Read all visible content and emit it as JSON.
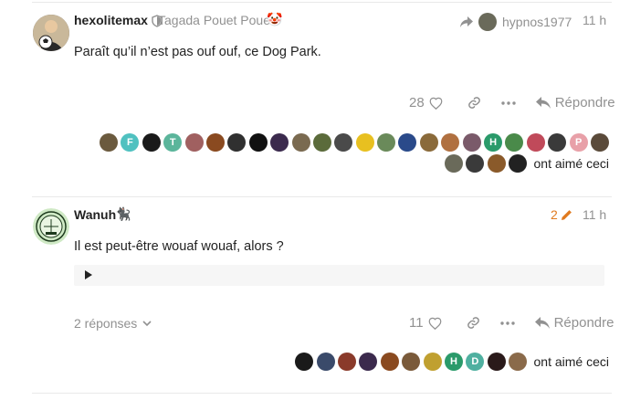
{
  "post1": {
    "username": "hexolitemax",
    "user_title": "Tagada Pouet Pouet",
    "title_emoji": "🤡",
    "reply_to": "hypnos1977",
    "time": "11 h",
    "body": "Paraît qu’il n’est pas ouf ouf, ce Dog Park.",
    "like_count": "28",
    "reply_label": "Répondre",
    "liked_text": "ont aimé ceci",
    "likers": [
      {
        "c": "#6b5a3e",
        "t": ""
      },
      {
        "c": "#4fc1c0",
        "t": "F"
      },
      {
        "c": "#1a1a1a",
        "t": ""
      },
      {
        "c": "#5bb59b",
        "t": "T"
      },
      {
        "c": "#a06060",
        "t": ""
      },
      {
        "c": "#8a4a20",
        "t": ""
      },
      {
        "c": "#303030",
        "t": ""
      },
      {
        "c": "#111111",
        "t": ""
      },
      {
        "c": "#3b2a4d",
        "t": ""
      },
      {
        "c": "#7a6a50",
        "t": ""
      },
      {
        "c": "#5b6b3b",
        "t": ""
      },
      {
        "c": "#4a4a4a",
        "t": ""
      },
      {
        "c": "#e8c020",
        "t": ""
      },
      {
        "c": "#6a8a5a",
        "t": ""
      },
      {
        "c": "#2a4a8a",
        "t": ""
      },
      {
        "c": "#8a6a3a",
        "t": ""
      },
      {
        "c": "#b07040",
        "t": ""
      },
      {
        "c": "#7a5a6a",
        "t": ""
      },
      {
        "c": "#2a9a6a",
        "t": "H"
      },
      {
        "c": "#4a8a4a",
        "t": ""
      },
      {
        "c": "#c04a5a",
        "t": ""
      },
      {
        "c": "#3a3a3a",
        "t": ""
      },
      {
        "c": "#e8a0a8",
        "t": "P"
      },
      {
        "c": "#5a4a3a",
        "t": ""
      },
      {
        "c": "#6a6a5a",
        "t": ""
      },
      {
        "c": "#3a3a3a",
        "t": ""
      },
      {
        "c": "#8a5a2a",
        "t": ""
      },
      {
        "c": "#222222",
        "t": ""
      }
    ]
  },
  "post2": {
    "username": "Wanuh",
    "edit_count": "2",
    "time": "11 h",
    "body": "Il est peut-être wouaf wouaf, alors ?",
    "replies_label": "2 réponses",
    "like_count": "11",
    "reply_label": "Répondre",
    "liked_text": "ont aimé ceci",
    "likers": [
      {
        "c": "#1a1a1a",
        "t": ""
      },
      {
        "c": "#3a4a6a",
        "t": ""
      },
      {
        "c": "#8a3a2a",
        "t": ""
      },
      {
        "c": "#3b2a4d",
        "t": ""
      },
      {
        "c": "#8a4a20",
        "t": ""
      },
      {
        "c": "#7a5a3a",
        "t": ""
      },
      {
        "c": "#c0a030",
        "t": ""
      },
      {
        "c": "#2a9a6a",
        "t": "H"
      },
      {
        "c": "#4fb0a0",
        "t": "D"
      },
      {
        "c": "#2a1a1a",
        "t": ""
      },
      {
        "c": "#8a6a4a",
        "t": ""
      }
    ]
  },
  "colors": {
    "accent_orange": "#e07a1f",
    "muted": "#919191"
  }
}
